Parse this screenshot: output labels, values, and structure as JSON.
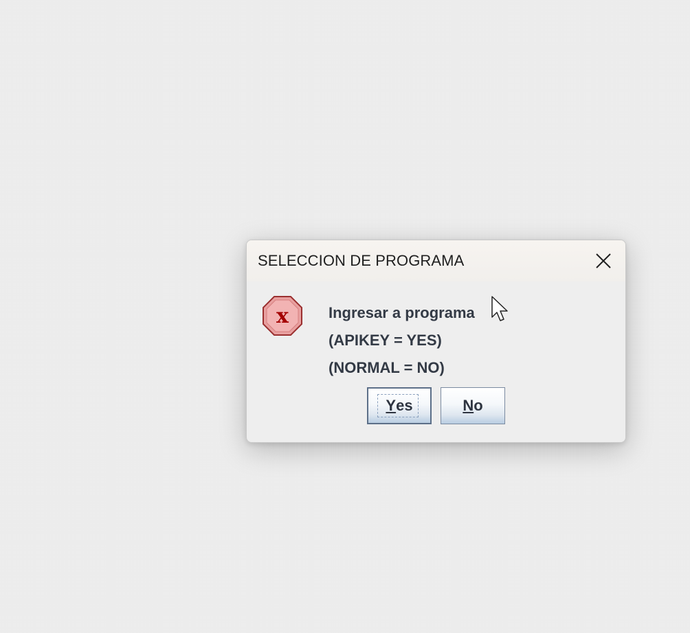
{
  "dialog": {
    "title": "SELECCION DE PROGRAMA",
    "message": {
      "line1": "Ingresar a programa",
      "line2": "(APIKEY = YES)",
      "line3": "(NORMAL = NO)"
    },
    "buttons": {
      "yes": {
        "mnemonic": "Y",
        "rest": "es"
      },
      "no": {
        "mnemonic": "N",
        "rest": "o"
      }
    }
  },
  "icons": {
    "close": "close-icon",
    "error": "error-icon",
    "cursor": "mouse-cursor-icon"
  },
  "colors": {
    "background": "#ebebeb",
    "dialog_bg": "#eeeeee",
    "error_red": "#e86a6a",
    "error_x": "#b00000",
    "button_gradient_bottom": "#b8cde2",
    "text": "#333a45"
  }
}
